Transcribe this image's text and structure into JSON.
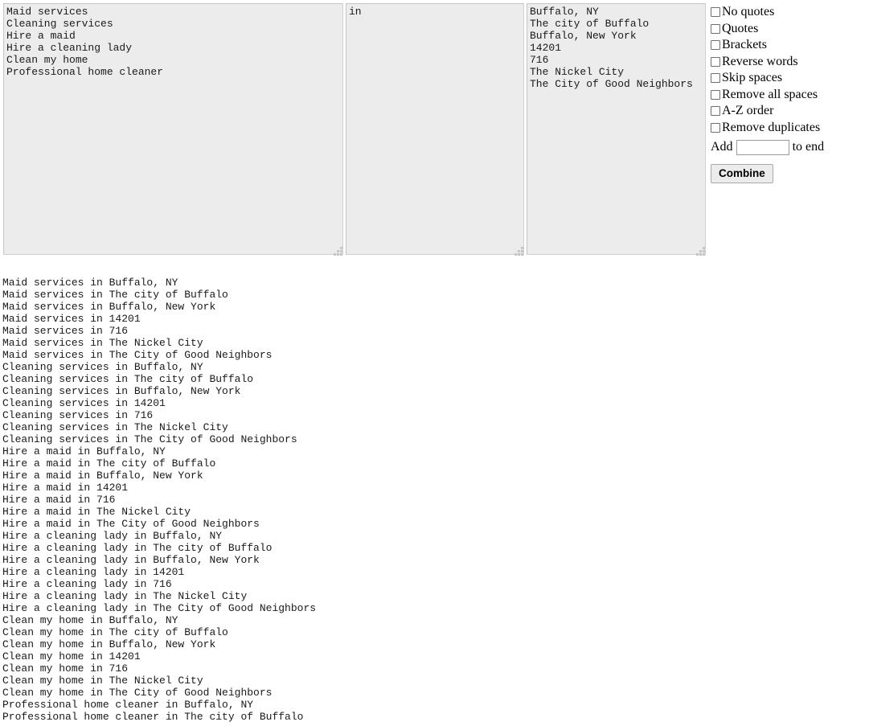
{
  "textareas": {
    "keywords": {
      "name": "keywords-textarea",
      "value": "Maid services\nCleaning services\nHire a maid\nHire a cleaning lady\nClean my home\nProfessional home cleaner"
    },
    "connector": {
      "name": "connector-textarea",
      "value": "in"
    },
    "locations": {
      "name": "locations-textarea",
      "value": "Buffalo, NY\nThe city of Buffalo\nBuffalo, New York\n14201\n716\nThe Nickel City\nThe City of Good Neighbors"
    }
  },
  "options": {
    "checkboxes": [
      {
        "id": "no-quotes",
        "label": "No quotes",
        "checked": false
      },
      {
        "id": "quotes",
        "label": "Quotes",
        "checked": false
      },
      {
        "id": "brackets",
        "label": "Brackets",
        "checked": false
      },
      {
        "id": "reverse-words",
        "label": "Reverse words",
        "checked": false
      },
      {
        "id": "skip-spaces",
        "label": "Skip spaces",
        "checked": false
      },
      {
        "id": "remove-all-spaces",
        "label": "Remove all spaces",
        "checked": false
      },
      {
        "id": "a-z-order",
        "label": "A-Z order",
        "checked": false
      },
      {
        "id": "remove-duplicates",
        "label": "Remove duplicates",
        "checked": false
      }
    ],
    "add_row": {
      "prefix_label": "Add",
      "suffix_label": "to end",
      "input_value": "",
      "input_placeholder": ""
    },
    "combine_button_label": "Combine"
  },
  "output": {
    "lines": [
      "Maid services in Buffalo, NY",
      "Maid services in The city of Buffalo",
      "Maid services in Buffalo, New York",
      "Maid services in 14201",
      "Maid services in 716",
      "Maid services in The Nickel City",
      "Maid services in The City of Good Neighbors",
      "Cleaning services in Buffalo, NY",
      "Cleaning services in The city of Buffalo",
      "Cleaning services in Buffalo, New York",
      "Cleaning services in 14201",
      "Cleaning services in 716",
      "Cleaning services in The Nickel City",
      "Cleaning services in The City of Good Neighbors",
      "Hire a maid in Buffalo, NY",
      "Hire a maid in The city of Buffalo",
      "Hire a maid in Buffalo, New York",
      "Hire a maid in 14201",
      "Hire a maid in 716",
      "Hire a maid in The Nickel City",
      "Hire a maid in The City of Good Neighbors",
      "Hire a cleaning lady in Buffalo, NY",
      "Hire a cleaning lady in The city of Buffalo",
      "Hire a cleaning lady in Buffalo, New York",
      "Hire a cleaning lady in 14201",
      "Hire a cleaning lady in 716",
      "Hire a cleaning lady in The Nickel City",
      "Hire a cleaning lady in The City of Good Neighbors",
      "Clean my home in Buffalo, NY",
      "Clean my home in The city of Buffalo",
      "Clean my home in Buffalo, New York",
      "Clean my home in 14201",
      "Clean my home in 716",
      "Clean my home in The Nickel City",
      "Clean my home in The City of Good Neighbors",
      "Professional home cleaner in Buffalo, NY",
      "Professional home cleaner in The city of Buffalo"
    ]
  },
  "colors": {
    "textarea_background": "#ececec",
    "textarea_border": "#cfcfcf",
    "button_background": "#ececec",
    "text": "#1a1a1a"
  }
}
